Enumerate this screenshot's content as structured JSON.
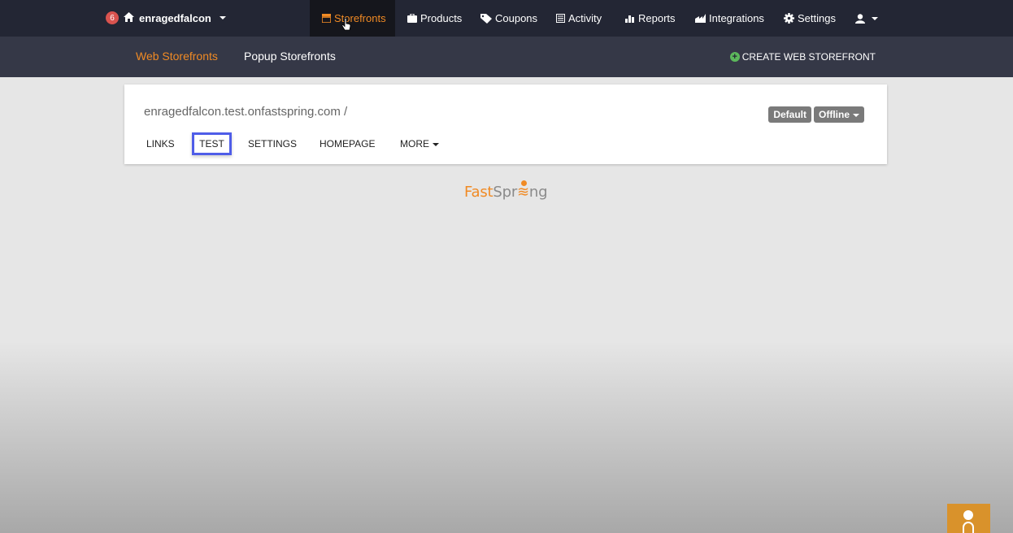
{
  "topbar": {
    "notification_count": "6",
    "account_name": "enragedfalcon",
    "nav": [
      {
        "label": "Storefronts",
        "icon": "storefront-icon",
        "active": true
      },
      {
        "label": "Products",
        "icon": "briefcase-icon"
      },
      {
        "label": "Coupons",
        "icon": "tag-icon"
      },
      {
        "label": "Activity",
        "icon": "list-icon"
      },
      {
        "label": "Reports",
        "icon": "chart-icon"
      },
      {
        "label": "Integrations",
        "icon": "integrations-icon"
      },
      {
        "label": "Settings",
        "icon": "gear-icon"
      }
    ]
  },
  "subbar": {
    "tabs": [
      {
        "label": "Web Storefronts",
        "active": true
      },
      {
        "label": "Popup Storefronts"
      }
    ],
    "create_label": "CREATE WEB STOREFRONT"
  },
  "card": {
    "domain": "enragedfalcon.test.onfastspring.com /",
    "default_label": "Default",
    "status_label": "Offline",
    "tabs": [
      {
        "label": "LINKS"
      },
      {
        "label": "TEST",
        "highlighted": true
      },
      {
        "label": "SETTINGS"
      },
      {
        "label": "HOMEPAGE"
      },
      {
        "label": "MORE"
      }
    ]
  },
  "logo": {
    "part1": "Fast",
    "part2": "Spr",
    "part3": "ng"
  },
  "colors": {
    "accent": "#f08a24",
    "topbar": "#232634",
    "subbar": "#353847",
    "highlight_border": "#4f5de8"
  }
}
